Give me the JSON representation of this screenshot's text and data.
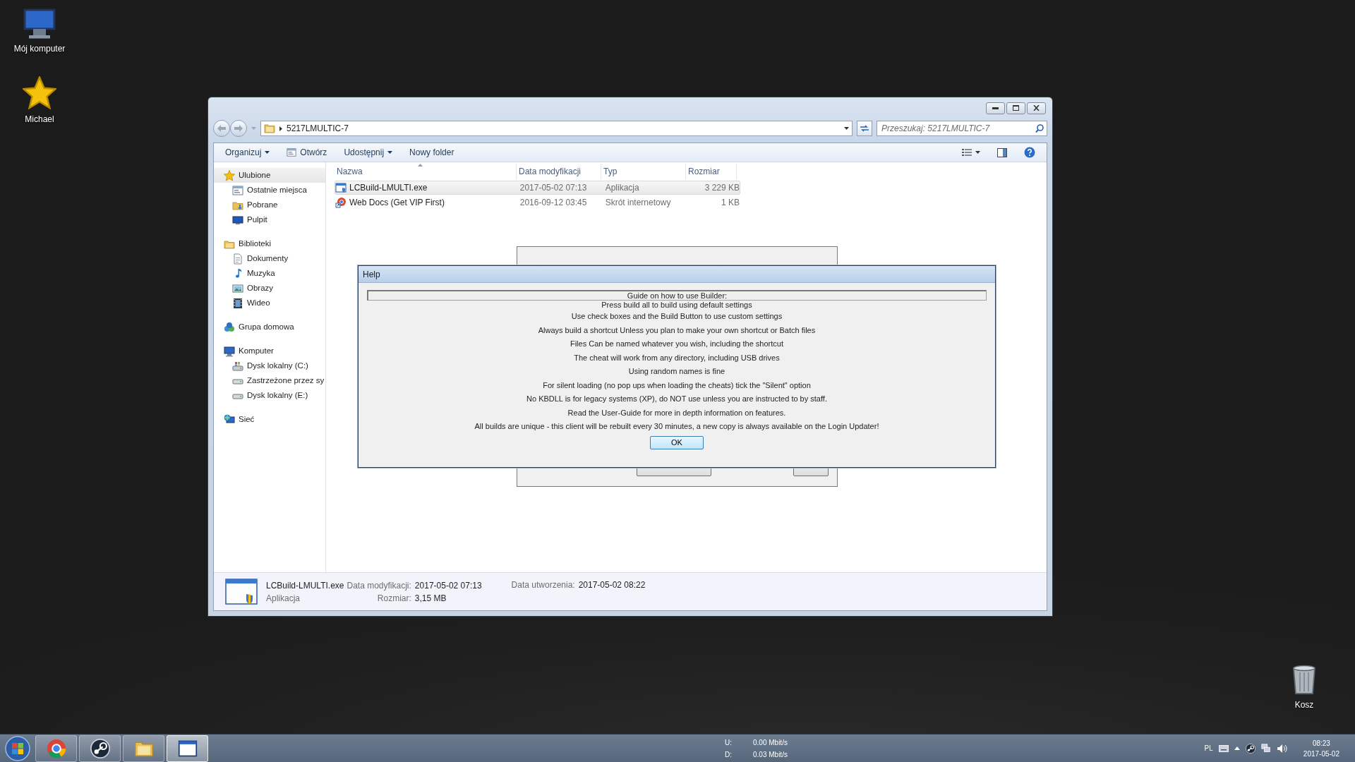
{
  "desktop_icons": [
    {
      "label": "Mój komputer",
      "kind": "computer"
    },
    {
      "label": "Michael",
      "kind": "star"
    },
    {
      "label": "Kosz",
      "kind": "bin"
    }
  ],
  "explorer": {
    "path": "5217LMULTIC-7",
    "search": {
      "placeholder": "Przeszukaj: 5217LMULTIC-7"
    },
    "toolbar": [
      {
        "label": "Organizuj",
        "kind": "menu"
      },
      {
        "label": "Otwórz",
        "kind": "command"
      },
      {
        "label": "Udostępnij",
        "kind": "menu"
      },
      {
        "label": "Nowy folder",
        "kind": "plain"
      }
    ],
    "sidebar": [
      {
        "label": "Ulubione",
        "kind": "star",
        "selected": true,
        "children": [
          {
            "label": "Ostatnie miejsca",
            "kind": "recent",
            "selected": false
          },
          {
            "label": "Pobrane",
            "kind": "download",
            "selected": false
          },
          {
            "label": "Pulpit",
            "kind": "desktop",
            "selected": false
          }
        ]
      },
      {
        "label": "Biblioteki",
        "kind": "library",
        "selected": false,
        "children": [
          {
            "label": "Dokumenty",
            "kind": "doc",
            "selected": false
          },
          {
            "label": "Muzyka",
            "kind": "music",
            "selected": false
          },
          {
            "label": "Obrazy",
            "kind": "pictures",
            "selected": false
          },
          {
            "label": "Wideo",
            "kind": "video",
            "selected": false
          }
        ]
      },
      {
        "label": "Grupa domowa",
        "kind": "homegroup",
        "selected": false
      },
      {
        "label": "Komputer",
        "kind": "computer",
        "selected": false,
        "children": [
          {
            "label": "Dysk lokalny (C:)",
            "kind": "drive-c",
            "selected": false
          },
          {
            "label": "Zastrzeżone przez sy",
            "kind": "drive",
            "selected": false
          },
          {
            "label": "Dysk lokalny (E:)",
            "kind": "drive",
            "selected": false
          }
        ]
      },
      {
        "label": "Sieć",
        "kind": "network",
        "selected": false
      }
    ],
    "columns": [
      {
        "label": "Nazwa",
        "sorted": true
      },
      {
        "label": "Data modyfikacji",
        "sorted": false
      },
      {
        "label": "Typ",
        "sorted": false
      },
      {
        "label": "Rozmiar",
        "sorted": false
      }
    ],
    "files": [
      {
        "name": "LCBuild-LMULTI.exe",
        "date": "2017-05-02 07:13",
        "type": "Aplikacja",
        "size": "3 229 KB",
        "kind": "exe",
        "selected": true
      },
      {
        "name": "Web Docs (Get VIP First)",
        "date": "2016-09-12 03:45",
        "type": "Skrót internetowy",
        "size": "1 KB",
        "kind": "url",
        "selected": false
      }
    ],
    "details": {
      "name": "LCBuild-LMULTI.exe",
      "type": "Aplikacja",
      "fields": [
        {
          "label": "Data modyfikacji:",
          "value": "2017-05-02 07:13"
        },
        {
          "label": "Rozmiar:",
          "value": "3,15 MB"
        },
        {
          "label": "Data utworzenia:",
          "value": "2017-05-02 08:22"
        }
      ]
    }
  },
  "help_dialog": {
    "title": "Help",
    "heading": "Guide on how to use Builder:",
    "lines": [
      "Press build all to build using default settings",
      "Use check boxes and the Build Button to use custom settings",
      "Always build a shortcut Unless you plan to make your own shortcut or Batch files",
      "Files Can be named whatever you wish, including the shortcut",
      "The cheat will work from any directory, including USB drives",
      "Using random names is fine",
      "For silent loading (no pop ups when loading the cheats) tick the \"Silent\" option",
      "No KBDLL is for legacy systems (XP), do NOT use unless you are instructed to by staff.",
      "Read the User-Guide for more in depth information on features.",
      "All builds are unique - this client will be rebuilt every 30 minutes, a new copy is always available on the Login Updater!"
    ],
    "ok": "OK"
  },
  "taskbar": {
    "apps": [
      {
        "kind": "circle",
        "selected": false
      },
      {
        "kind": "knob",
        "selected": false
      },
      {
        "kind": "folder",
        "selected": false
      },
      {
        "kind": "window",
        "selected": true
      }
    ],
    "net": [
      {
        "label": "U:",
        "value": "0.00 Mbit/s"
      },
      {
        "label": "D:",
        "value": "0.03 Mbit/s"
      }
    ],
    "language": "PL",
    "time": "08:23",
    "date": "2017-05-02"
  }
}
